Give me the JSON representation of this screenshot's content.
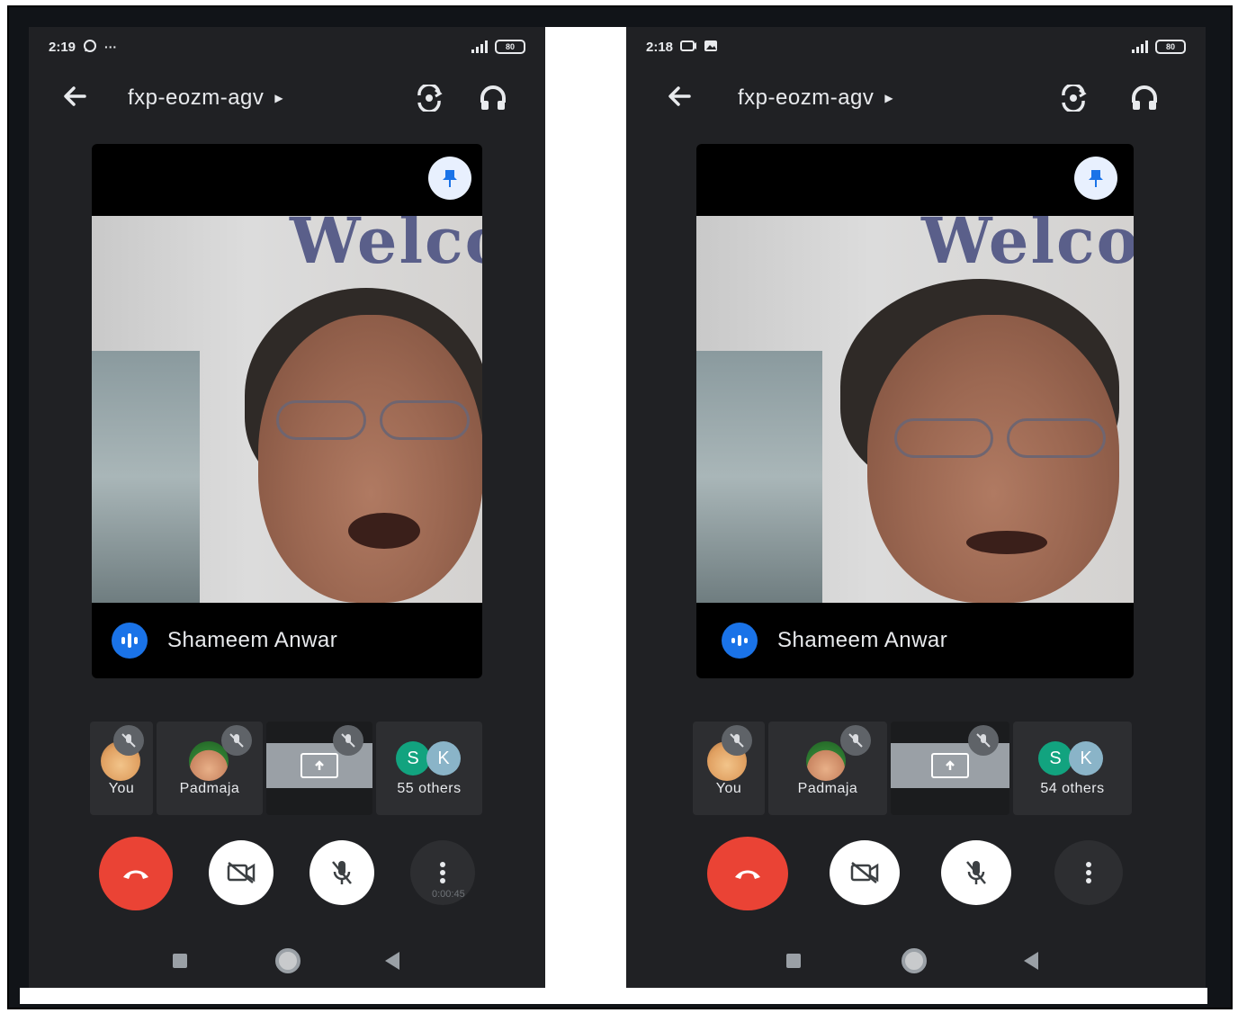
{
  "screens": [
    {
      "status": {
        "time": "2:19",
        "icon_1": "whatsapp-icon",
        "icon_2": "···",
        "battery": "80"
      },
      "meeting_code": "fxp-eozm-agv",
      "main_tile": {
        "speaker_name": "Shameem Anwar",
        "background_text": "Welco"
      },
      "participants": [
        {
          "label": "You"
        },
        {
          "label": "Padmaja"
        },
        {
          "label": ""
        },
        {
          "label": "55 others",
          "initials": [
            "S",
            "K"
          ]
        }
      ],
      "record_text": "0:00:45"
    },
    {
      "status": {
        "time": "2:18",
        "icon_1": "cast-icon",
        "icon_2": "gallery-icon",
        "battery": "80"
      },
      "meeting_code": "fxp-eozm-agv",
      "main_tile": {
        "speaker_name": "Shameem Anwar",
        "background_text": "Welco"
      },
      "participants": [
        {
          "label": "You"
        },
        {
          "label": "Padmaja"
        },
        {
          "label": ""
        },
        {
          "label": "54 others",
          "initials": [
            "S",
            "K"
          ]
        }
      ]
    }
  ],
  "colors": {
    "background": "#202124",
    "end_call": "#ea4335",
    "speaking": "#1a73e8",
    "avatar_s": "#12a37f",
    "avatar_k": "#8ab4c8"
  },
  "icons": [
    "back-arrow-icon",
    "caret-right-icon",
    "switch-camera-icon",
    "headphones-icon",
    "pin-icon",
    "speaking-icon",
    "mic-off-icon",
    "present-icon",
    "end-call-icon",
    "camera-off-icon",
    "more-vert-icon",
    "nav-recents-icon",
    "nav-home-icon",
    "nav-back-icon"
  ]
}
